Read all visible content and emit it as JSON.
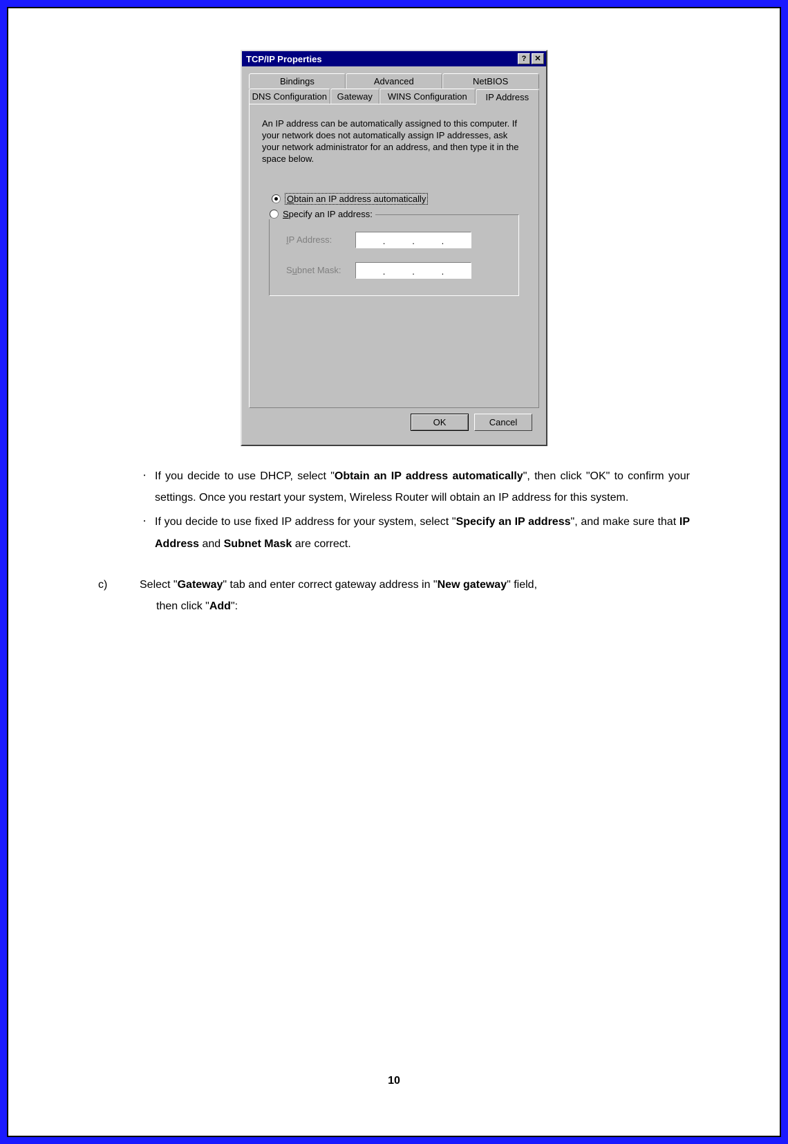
{
  "dialog": {
    "title": "TCP/IP Properties",
    "help_btn": "?",
    "close_btn": "✕",
    "tabs_row1": [
      "Bindings",
      "Advanced",
      "NetBIOS"
    ],
    "tabs_row2": [
      "DNS Configuration",
      "Gateway",
      "WINS Configuration",
      "IP Address"
    ],
    "info_text": "An IP address can be automatically assigned to this computer. If your network does not automatically assign IP addresses, ask your network administrator for an address, and then type it in the space below.",
    "radio_obtain": "Obtain an IP address automatically",
    "radio_specify": "Specify an IP address:",
    "field_ip": "IP Address:",
    "field_mask": "Subnet Mask:",
    "ok": "OK",
    "cancel": "Cancel"
  },
  "doc": {
    "bullet1_a": "If you decide to use DHCP, select \"",
    "bullet1_b": "Obtain an IP address automatically",
    "bullet1_c": "\", then click \"OK\" to confirm your settings.  Once you restart your system, Wireless Router will obtain an IP address for this system.",
    "bullet2_a": "If you decide to use fixed IP address for your system, select \"",
    "bullet2_b": "Specify an IP address",
    "bullet2_c": "\", and make sure that ",
    "bullet2_d": "IP Address",
    "bullet2_e": " and ",
    "bullet2_f": "Subnet Mask",
    "bullet2_g": " are correct.",
    "step_letter": "c)",
    "step_a": "Select \"",
    "step_b": "Gateway",
    "step_c": "\" tab and enter correct gateway address in \"",
    "step_d": "New gateway",
    "step_e": "\" field,",
    "step_f": "then click \"",
    "step_g": "Add",
    "step_h": "\":"
  },
  "page_number": "10"
}
